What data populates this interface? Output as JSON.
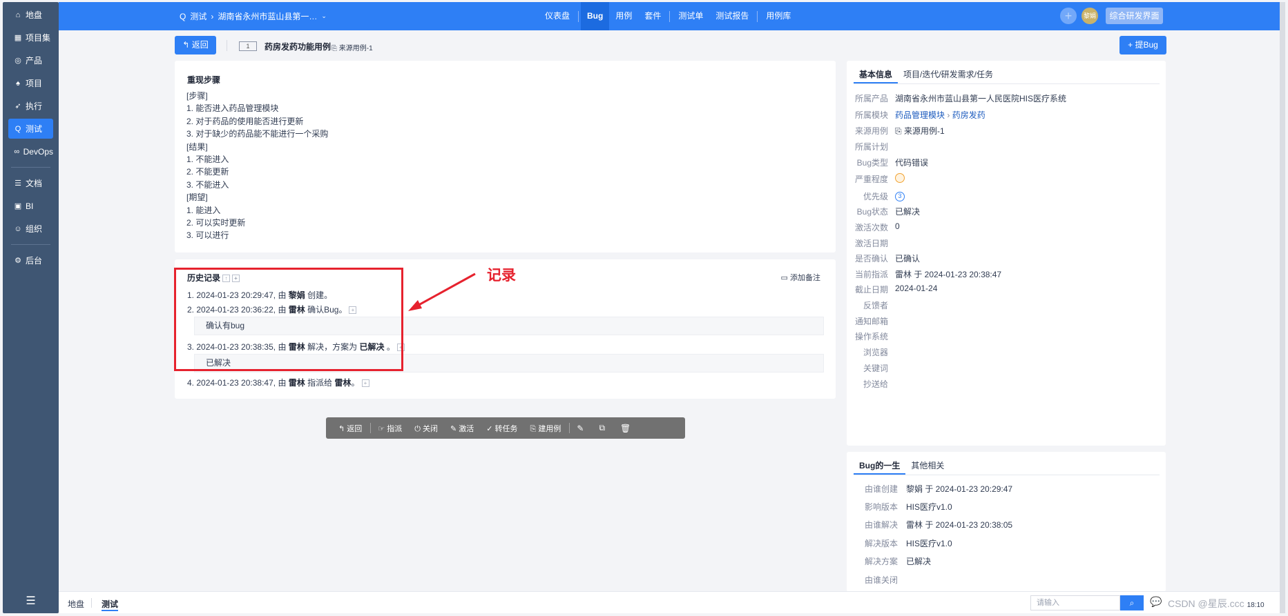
{
  "sidebar": {
    "items": [
      {
        "icon": "home-icon",
        "label": "地盘"
      },
      {
        "icon": "grid-icon",
        "label": "项目集"
      },
      {
        "icon": "location-icon",
        "label": "产品"
      },
      {
        "icon": "bell-icon",
        "label": "项目"
      },
      {
        "icon": "run-icon",
        "label": "执行"
      },
      {
        "icon": "test-icon",
        "label": "测试"
      },
      {
        "icon": "infinity-icon",
        "label": "DevOps"
      },
      {
        "icon": "doc-icon",
        "label": "文档"
      },
      {
        "icon": "chart-icon",
        "label": "BI"
      },
      {
        "icon": "org-icon",
        "label": "组织"
      },
      {
        "icon": "gear-icon",
        "label": "后台"
      }
    ],
    "active": "测试"
  },
  "topbar": {
    "breadcrumb_root": "测试",
    "breadcrumb_product": "湖南省永州市蓝山县第一…",
    "nav": [
      "仪表盘",
      "Bug",
      "用例",
      "套件",
      "测试单",
      "测试报告",
      "用例库"
    ],
    "active_nav": "Bug",
    "avatar_text": "黎娟",
    "switch_label": "综合研发界面"
  },
  "header": {
    "back_label": "返回",
    "bug_id": "1",
    "bug_title": "药房发药功能用例",
    "source_case": "来源用例-1",
    "add_bug_label": "提Bug"
  },
  "repro": {
    "title": "重现步骤",
    "lines": [
      "[步骤]",
      "1. 能否进入药品管理模块",
      "2. 对于药品的使用能否进行更新",
      "3. 对于缺少的药品能不能进行一个采购",
      "[结果]",
      "1. 不能进入",
      "2. 不能更新",
      "3. 不能进入",
      "[期望]",
      "1. 能进入",
      "2. 可以实时更新",
      "3. 可以进行"
    ]
  },
  "history": {
    "title": "历史记录",
    "add_note": "添加备注",
    "entries": [
      {
        "prefix": "1. 2024-01-23 20:29:47, 由 ",
        "user": "黎娟",
        "action": " 创建。"
      },
      {
        "prefix": "2. 2024-01-23 20:36:22, 由 ",
        "user": "雷林",
        "action": " 确认Bug。"
      },
      {
        "prefix": "3. 2024-01-23 20:38:35, 由 ",
        "user": "雷林",
        "action": " 解决，方案为 ",
        "bold2": "已解决",
        "tail": " 。"
      },
      {
        "prefix": "4. 2024-01-23 20:38:47, 由 ",
        "user": "雷林",
        "action": " 指派给 ",
        "bold2": "雷林",
        "tail": "。"
      }
    ],
    "comments": [
      "确认有bug",
      "已解决"
    ]
  },
  "annotation": {
    "label": "记录",
    "color": "#e6222e"
  },
  "toolbar": {
    "back": "返回",
    "assign": "指派",
    "close": "关闭",
    "activate": "激活",
    "to_task": "转任务",
    "create_case": "建用例"
  },
  "info": {
    "tabs": [
      "基本信息",
      "项目/迭代/研发需求/任务"
    ],
    "rows": [
      {
        "label": "所属产品",
        "value": "湖南省永州市蓝山县第一人民医院HIS医疗系统"
      },
      {
        "label": "所属模块",
        "value": "药品管理模块",
        "value2": "药房发药"
      },
      {
        "label": "来源用例",
        "value": "来源用例-1"
      },
      {
        "label": "所属计划",
        "value": ""
      },
      {
        "label": "Bug类型",
        "value": "代码错误"
      },
      {
        "label": "严重程度",
        "value": ""
      },
      {
        "label": "优先级",
        "value": "3"
      },
      {
        "label": "Bug状态",
        "value": "已解决"
      },
      {
        "label": "激活次数",
        "value": "0"
      },
      {
        "label": "激活日期",
        "value": ""
      },
      {
        "label": "是否确认",
        "value": "已确认"
      },
      {
        "label": "当前指派",
        "value": "雷林 于 2024-01-23 20:38:47"
      },
      {
        "label": "截止日期",
        "value": "2024-01-24"
      },
      {
        "label": "反馈者",
        "value": ""
      },
      {
        "label": "通知邮箱",
        "value": ""
      },
      {
        "label": "操作系统",
        "value": ""
      },
      {
        "label": "浏览器",
        "value": ""
      },
      {
        "label": "关键词",
        "value": ""
      },
      {
        "label": "抄送给",
        "value": ""
      }
    ]
  },
  "life": {
    "tabs": [
      "Bug的一生",
      "其他相关"
    ],
    "rows": [
      {
        "label": "由谁创建",
        "value": "黎娟 于 2024-01-23 20:29:47"
      },
      {
        "label": "影响版本",
        "value": "HIS医疗v1.0"
      },
      {
        "label": "由谁解决",
        "value": "雷林 于 2024-01-23 20:38:05"
      },
      {
        "label": "解决版本",
        "value": "HIS医疗v1.0"
      },
      {
        "label": "解决方案",
        "value": "已解决"
      },
      {
        "label": "由谁关闭",
        "value": ""
      }
    ]
  },
  "statusbar": {
    "home": "地盘",
    "current": "测试",
    "search_placeholder": "请输入",
    "time": "18:10",
    "watermark": "CSDN @星辰.ccc"
  },
  "colors": {
    "primary": "#2e7ff5",
    "sidebar": "#3f5673",
    "resolved": "#1fa34a",
    "annotation": "#e6222e"
  }
}
